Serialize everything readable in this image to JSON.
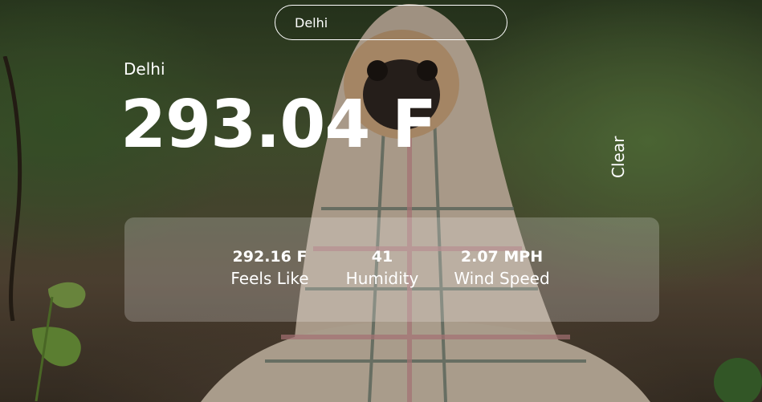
{
  "search": {
    "value": "Delhi"
  },
  "weather": {
    "city": "Delhi",
    "temperature": "293.04 F",
    "clear_label": "Clear",
    "stats": [
      {
        "value": "292.16 F",
        "label": "Feels Like"
      },
      {
        "value": "41",
        "label": "Humidity"
      },
      {
        "value": "2.07 MPH",
        "label": "Wind Speed"
      }
    ]
  },
  "colors": {
    "text": "#ffffff",
    "panel": "rgba(255,255,255,0.22)"
  }
}
